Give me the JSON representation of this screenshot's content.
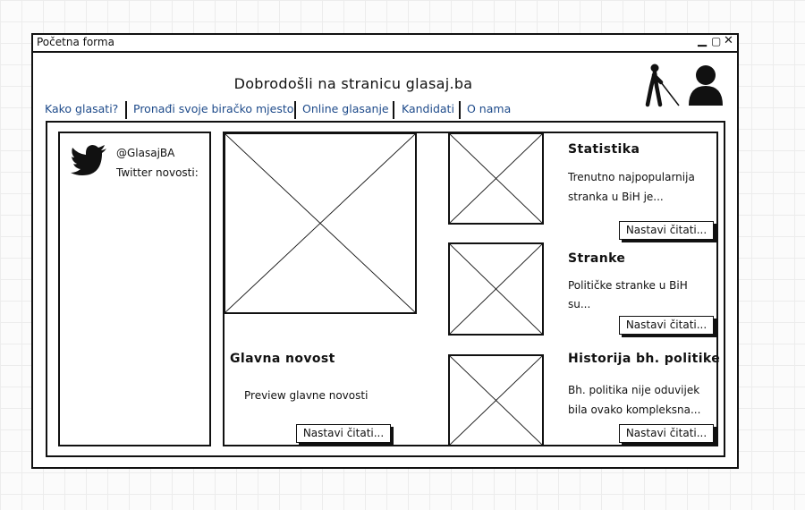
{
  "window": {
    "title": "Početna forma",
    "controls": "▁▢✕"
  },
  "header": {
    "title": "Dobrodošli na stranicu glasaj.ba",
    "icons": [
      "blind-person-icon",
      "user-icon"
    ]
  },
  "nav": {
    "items": [
      {
        "label": "Kako glasati?"
      },
      {
        "label": "Pronađi svoje biračko mjesto"
      },
      {
        "label": "Online glasanje"
      },
      {
        "label": "Kandidati"
      },
      {
        "label": "O nama"
      }
    ]
  },
  "sidebar": {
    "handle": "@GlasajBA",
    "label": "Twitter novosti:",
    "icon": "twitter-bird-icon"
  },
  "main_news": {
    "title": "Glavna novost",
    "preview": "Preview glavne novosti",
    "button": "Nastavi čitati..."
  },
  "articles": [
    {
      "title": "Statistika",
      "lines": [
        "Trenutno najpopularnija",
        "stranka u BiH je..."
      ],
      "button": "Nastavi čitati..."
    },
    {
      "title": "Stranke",
      "lines": [
        "Političke stranke u BiH",
        "su..."
      ],
      "button": "Nastavi čitati..."
    },
    {
      "title": "Historija bh. politike",
      "lines": [
        "Bh. politika nije oduvijek",
        "bila ovako kompleksna..."
      ],
      "button": "Nastavi čitati..."
    }
  ]
}
